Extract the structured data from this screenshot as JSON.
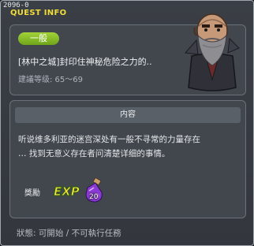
{
  "window": {
    "id_label": "2096-0",
    "title": "QUEST INFO"
  },
  "quest": {
    "category": "一般",
    "title": "[林中之城]封印住神秘危险之力的..",
    "level_text": "建議等级: 65～69",
    "npc_icon": "bald-bearded-npc-portrait"
  },
  "description": {
    "header": "内容",
    "lines": [
      "听说维多利亚的迷宫深处有一般不寻常的力量存在",
      "… 找到无意义存在者问清楚详细的事情。"
    ]
  },
  "reward": {
    "label": "獎勵",
    "exp_icon": "exp-icon",
    "item_icon": "purple-potion-icon",
    "item_quantity": "20"
  },
  "status": {
    "text": "狀態: 可開始 / 不可執行任務"
  },
  "colors": {
    "title": "#f2dc3a",
    "badge": "#8cc02a",
    "panel": "#42474e",
    "border": "#9ea5ad"
  }
}
